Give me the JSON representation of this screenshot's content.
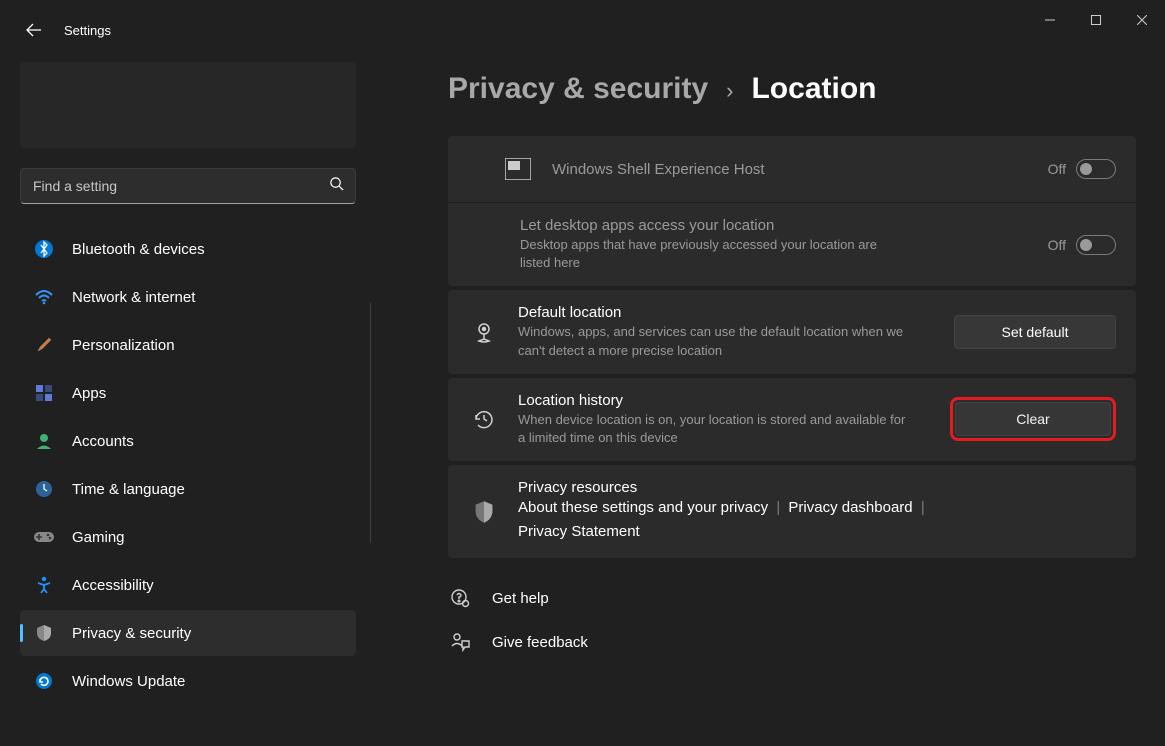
{
  "app_title": "Settings",
  "search": {
    "placeholder": "Find a setting"
  },
  "sidebar": {
    "items": [
      {
        "label": "Bluetooth & devices"
      },
      {
        "label": "Network & internet"
      },
      {
        "label": "Personalization"
      },
      {
        "label": "Apps"
      },
      {
        "label": "Accounts"
      },
      {
        "label": "Time & language"
      },
      {
        "label": "Gaming"
      },
      {
        "label": "Accessibility"
      },
      {
        "label": "Privacy & security"
      },
      {
        "label": "Windows Update"
      }
    ]
  },
  "breadcrumb": {
    "parent": "Privacy & security",
    "current": "Location"
  },
  "rows": {
    "shell_host": {
      "title": "Windows Shell Experience Host",
      "state": "Off"
    },
    "desktop_apps": {
      "title": "Let desktop apps access your location",
      "sub": "Desktop apps that have previously accessed your location are listed here",
      "state": "Off"
    },
    "default_location": {
      "title": "Default location",
      "sub": "Windows, apps, and services can use the default location when we can't detect a more precise location",
      "button": "Set default"
    },
    "history": {
      "title": "Location history",
      "sub": "When device location is on, your location is stored and available for a limited time on this device",
      "button": "Clear"
    },
    "resources": {
      "title": "Privacy resources",
      "link1": "About these settings and your privacy",
      "link2": "Privacy dashboard",
      "link3": "Privacy Statement"
    }
  },
  "footer": {
    "help": "Get help",
    "feedback": "Give feedback"
  }
}
